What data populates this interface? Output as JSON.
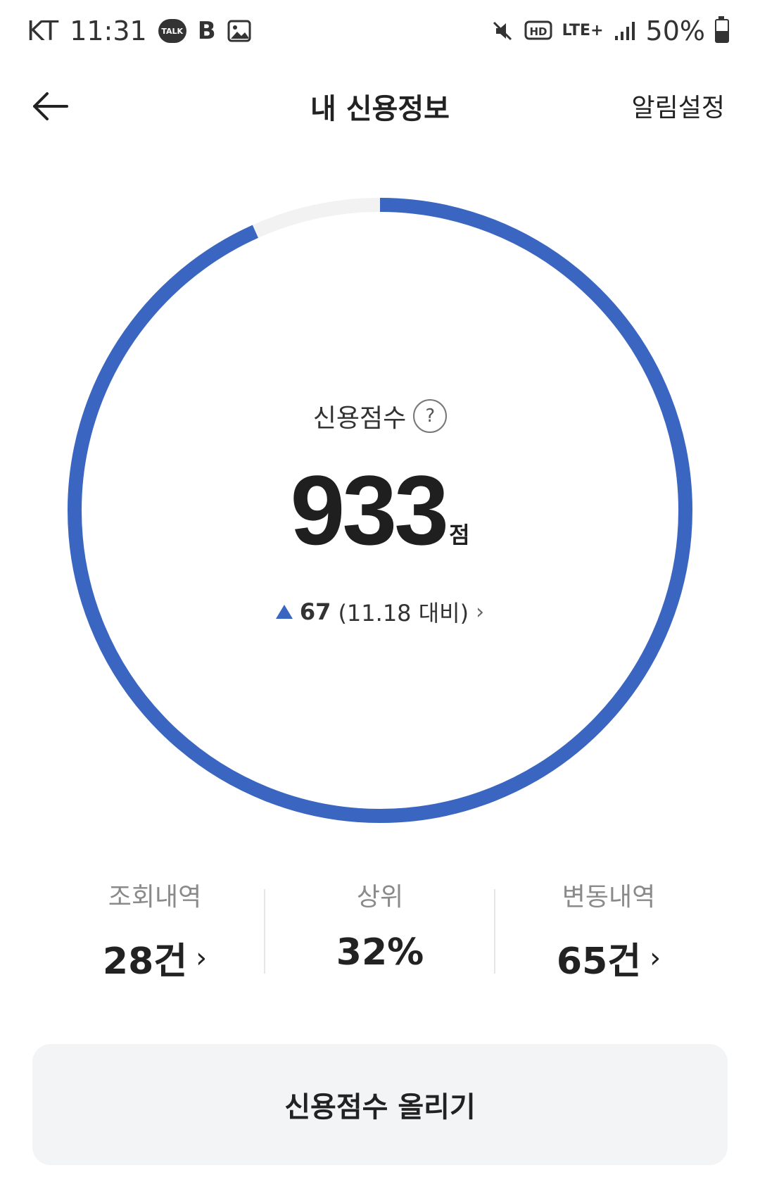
{
  "status_bar": {
    "carrier": "KT",
    "time": "11:31",
    "talk_badge": "TALK",
    "b_icon_label": "B",
    "hd_label": "HD",
    "network": "LTE+",
    "battery_text": "50%",
    "battery_level": 0.5
  },
  "header": {
    "title": "내 신용정보",
    "alarm_settings": "알림설정"
  },
  "score": {
    "label": "신용점수",
    "help_icon": "?",
    "value": "933",
    "unit": "점",
    "change_value": "67",
    "change_compare": "(11.18 대비)",
    "gauge_fraction": 0.933,
    "gauge_color": "#3a66c2",
    "track_color": "#f2f2f2"
  },
  "stats": [
    {
      "label": "조회내역",
      "value": "28건",
      "has_chevron": true
    },
    {
      "label": "상위",
      "value": "32%",
      "has_chevron": false
    },
    {
      "label": "변동내역",
      "value": "65건",
      "has_chevron": true
    }
  ],
  "actions": {
    "raise_score_label": "신용점수 올리기"
  },
  "icons": [
    "talk-icon",
    "b-icon",
    "gallery-icon",
    "mute-icon",
    "hd-icon",
    "signal-icon",
    "battery-icon",
    "back-arrow-icon",
    "help-icon",
    "triangle-up-icon",
    "chevron-right-icon"
  ]
}
